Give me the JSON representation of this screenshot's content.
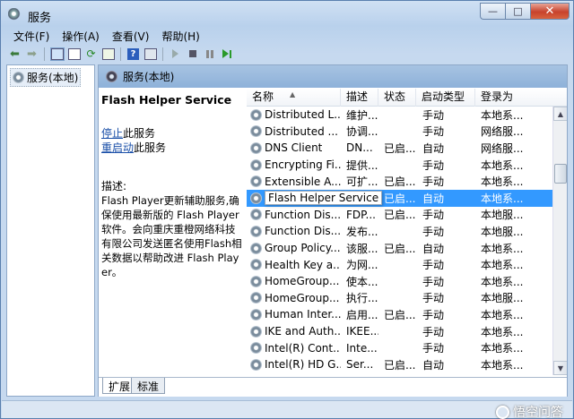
{
  "window": {
    "title": "服务",
    "buttons": {
      "minimize": "—",
      "maximize": "□",
      "close": "✕"
    }
  },
  "menu": [
    "文件(F)",
    "操作(A)",
    "查看(V)",
    "帮助(H)"
  ],
  "toolbar": {
    "icons": [
      "back-arrow-icon",
      "forward-arrow-icon",
      "show-tree-icon",
      "properties-icon",
      "refresh-icon",
      "export-list-icon",
      "help-icon",
      "start-icon",
      "stop-icon",
      "pause-icon",
      "restart-icon"
    ],
    "help_glyph": "?"
  },
  "tree": {
    "root_label": "服务(本地)"
  },
  "pane": {
    "header": "服务(本地)",
    "selected_service": "Flash Helper Service",
    "action_stop_link": "停止",
    "action_stop_suffix": "此服务",
    "action_restart_link": "重启动",
    "action_restart_suffix": "此服务",
    "description_label": "描述:",
    "description_text": "Flash Player更新辅助服务,确保使用最新版的 Flash Player 软件。会向重庆重橙网络科技有限公司发送匿名使用Flash相关数据以帮助改进 Flash Player。"
  },
  "columns": {
    "name": "名称",
    "desc": "描述",
    "status": "状态",
    "startup": "启动类型",
    "logon": "登录为"
  },
  "services": [
    {
      "name": "Distributed L...",
      "desc": "维护...",
      "status": "",
      "startup": "手动",
      "logon": "本地系..."
    },
    {
      "name": "Distributed ...",
      "desc": "协调...",
      "status": "",
      "startup": "手动",
      "logon": "网络服..."
    },
    {
      "name": "DNS Client",
      "desc": "DN...",
      "status": "已启...",
      "startup": "自动",
      "logon": "网络服..."
    },
    {
      "name": "Encrypting Fi...",
      "desc": "提供...",
      "status": "",
      "startup": "手动",
      "logon": "本地系..."
    },
    {
      "name": "Extensible A...",
      "desc": "可扩...",
      "status": "已启...",
      "startup": "手动",
      "logon": "本地系..."
    },
    {
      "name": "Flash Helper Service",
      "desc": "",
      "status": "已启...",
      "startup": "自动",
      "logon": "本地系..."
    },
    {
      "name": "Function Dis...",
      "desc": "FDP...",
      "status": "已启...",
      "startup": "手动",
      "logon": "本地服..."
    },
    {
      "name": "Function Dis...",
      "desc": "发布...",
      "status": "",
      "startup": "手动",
      "logon": "本地服..."
    },
    {
      "name": "Group Policy...",
      "desc": "该服...",
      "status": "已启...",
      "startup": "自动",
      "logon": "本地系..."
    },
    {
      "name": "Health Key a...",
      "desc": "为网...",
      "status": "",
      "startup": "手动",
      "logon": "本地系..."
    },
    {
      "name": "HomeGroup...",
      "desc": "使本...",
      "status": "",
      "startup": "手动",
      "logon": "本地系..."
    },
    {
      "name": "HomeGroup...",
      "desc": "执行...",
      "status": "",
      "startup": "手动",
      "logon": "本地服..."
    },
    {
      "name": "Human Inter...",
      "desc": "启用...",
      "status": "已启...",
      "startup": "手动",
      "logon": "本地系..."
    },
    {
      "name": "IKE and Auth...",
      "desc": "IKEE...",
      "status": "",
      "startup": "手动",
      "logon": "本地系..."
    },
    {
      "name": "Intel(R) Cont...",
      "desc": "Inte...",
      "status": "",
      "startup": "手动",
      "logon": "本地系..."
    },
    {
      "name": "Intel(R) HD G...",
      "desc": "Ser...",
      "status": "已启...",
      "startup": "自动",
      "logon": "本地系..."
    }
  ],
  "selected_index": 5,
  "tabs": [
    "扩展",
    "标准"
  ],
  "watermark": "悟空问答"
}
